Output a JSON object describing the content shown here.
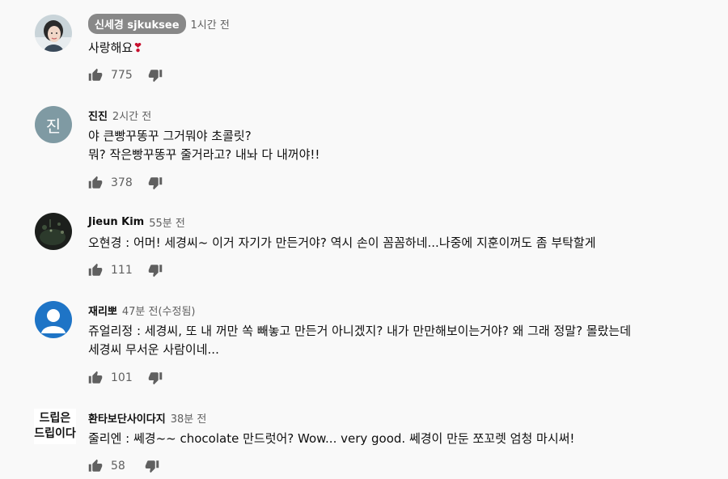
{
  "comments": [
    {
      "author": "신세경 sjkuksee",
      "author_is_channel_owner": true,
      "time": "1시간 전",
      "lines": [
        "사랑해요"
      ],
      "emoji": "❣",
      "likes": "775",
      "avatar": "photo-woman-icon"
    },
    {
      "author": "진진",
      "time": "2시간 전",
      "lines": [
        "야 큰빵꾸똥꾸 그거뭐야 초콜릿?",
        "뭐? 작은빵꾸똥꾸 줄거라고? 내놔 다 내꺼야!!"
      ],
      "likes": "378",
      "avatar_letter": "진"
    },
    {
      "author": "Jieun Kim",
      "time": "55분 전",
      "lines": [
        "오현경 : 어머! 세경씨~ 이거 자기가 만든거야? 역시 손이 꼼꼼하네...나중에 지훈이꺼도 좀 부탁할게"
      ],
      "likes": "111",
      "avatar": "photo-night-icon"
    },
    {
      "author": "재리뽀",
      "time": "47분 전(수정됨)",
      "lines": [
        "쥬얼리정 : 세경씨, 또 내 꺼만 쏙 빼놓고 만든거 아니겠지? 내가 만만해보이는거야? 왜 그래 정말? 몰랐는데",
        "세경씨 무서운 사람이네..."
      ],
      "likes": "101",
      "avatar": "default-user-icon"
    },
    {
      "author": "환타보단사이다지",
      "time": "38분 전",
      "lines": [
        "줄리엔 : 쎄경~~ chocolate 만드럿어? Wow... very good. 쎄경이 만둔 쪼꼬렛 엄청 마시써!"
      ],
      "likes": "58",
      "avatar_text": [
        "드립은",
        "드립이다"
      ]
    }
  ]
}
